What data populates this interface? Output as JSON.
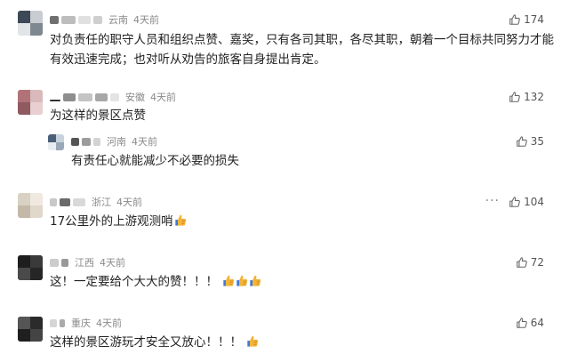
{
  "comments": [
    {
      "location": "云南",
      "time": "4天前",
      "text_line1": "对负责任的职守人员和组织点赞、嘉奖，只有各司其职，各尽其职，朝着一个目标共同努力才能",
      "text_line2": "有效迅速完成；也对听从劝告的旅客自身提出肯定。",
      "likes": "174"
    },
    {
      "location": "安徽",
      "time": "4天前",
      "text": "为这样的景区点赞",
      "likes": "132"
    },
    {
      "location": "河南",
      "time": "4天前",
      "text": "有责任心就能减少不必要的损失",
      "likes": "35"
    },
    {
      "location": "浙江",
      "time": "4天前",
      "text": "17公里外的上游观测哨",
      "emoji_count": 1,
      "more": "···",
      "likes": "104"
    },
    {
      "location": "江西",
      "time": "4天前",
      "text": "这！一定要给个大大的赞！！！",
      "emoji_count": 3,
      "likes": "72"
    },
    {
      "location": "重庆",
      "time": "4天前",
      "text": "这样的景区游玩才安全又放心！！！",
      "emoji_count": 1,
      "likes": "64"
    }
  ],
  "icons": {
    "like": "thumbs-up-outline-icon",
    "emoji": "thumbs-up-emoji-icon"
  },
  "colors": {
    "meta": "#8a8a8a",
    "text": "#222222",
    "emoji": "#f3b43a"
  }
}
